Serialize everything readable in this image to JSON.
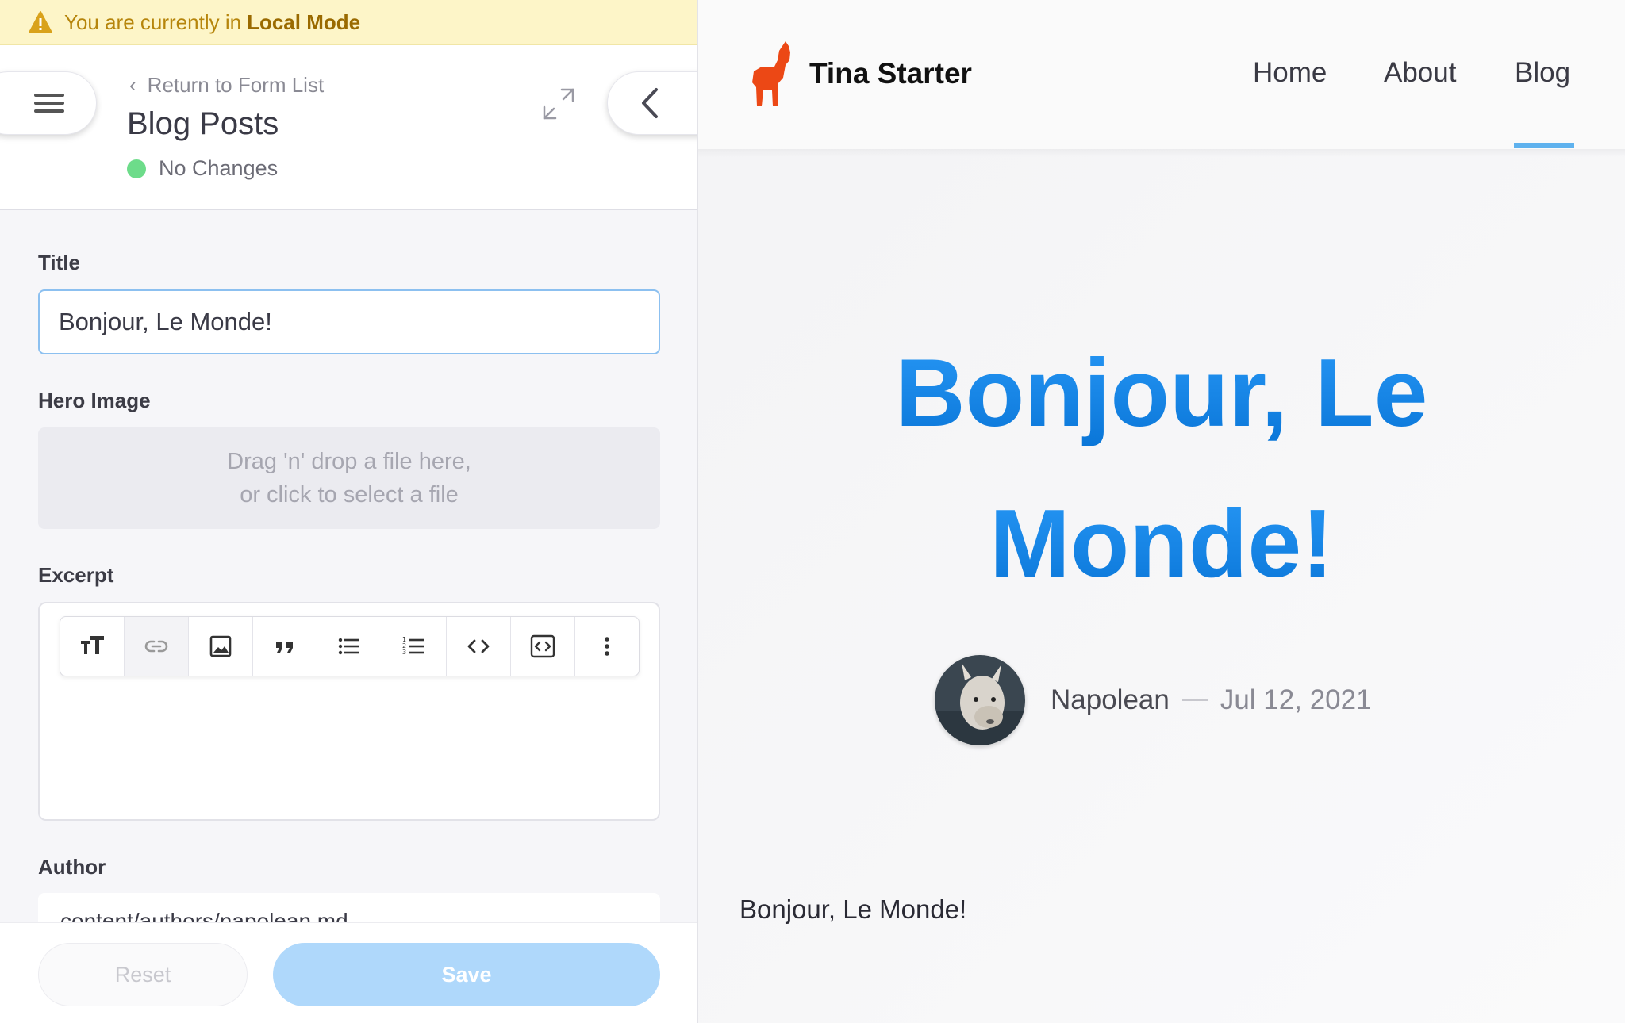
{
  "banner": {
    "prefix": "You are currently in",
    "mode": "Local Mode"
  },
  "form": {
    "return_label": "Return to Form List",
    "title": "Blog Posts",
    "status": "No Changes",
    "fields": {
      "title": {
        "label": "Title",
        "value": "Bonjour, Le Monde!"
      },
      "hero_image": {
        "label": "Hero Image",
        "drop_line1": "Drag 'n' drop a file here,",
        "drop_line2": "or click to select a file"
      },
      "excerpt": {
        "label": "Excerpt",
        "toolbar": [
          "heading-icon",
          "link-icon",
          "image-icon",
          "quote-icon",
          "bulleted-list-icon",
          "numbered-list-icon",
          "code-icon",
          "code-block-icon",
          "more-icon"
        ]
      },
      "author": {
        "label": "Author",
        "value": "content/authors/napolean.md"
      }
    },
    "reset_label": "Reset",
    "save_label": "Save"
  },
  "site": {
    "name": "Tina Starter",
    "nav": [
      "Home",
      "About",
      "Blog"
    ],
    "active_nav": "Blog",
    "post": {
      "title_line1": "Bonjour, Le",
      "title_line2": "Monde!",
      "author": "Napolean",
      "date": "Jul 12, 2021",
      "body": "Bonjour, Le Monde!"
    }
  },
  "colors": {
    "accent": "#1b8ef0",
    "logo": "#ec4815",
    "status_ok": "#6ddc8a",
    "banner_bg": "#fdf5c8"
  }
}
